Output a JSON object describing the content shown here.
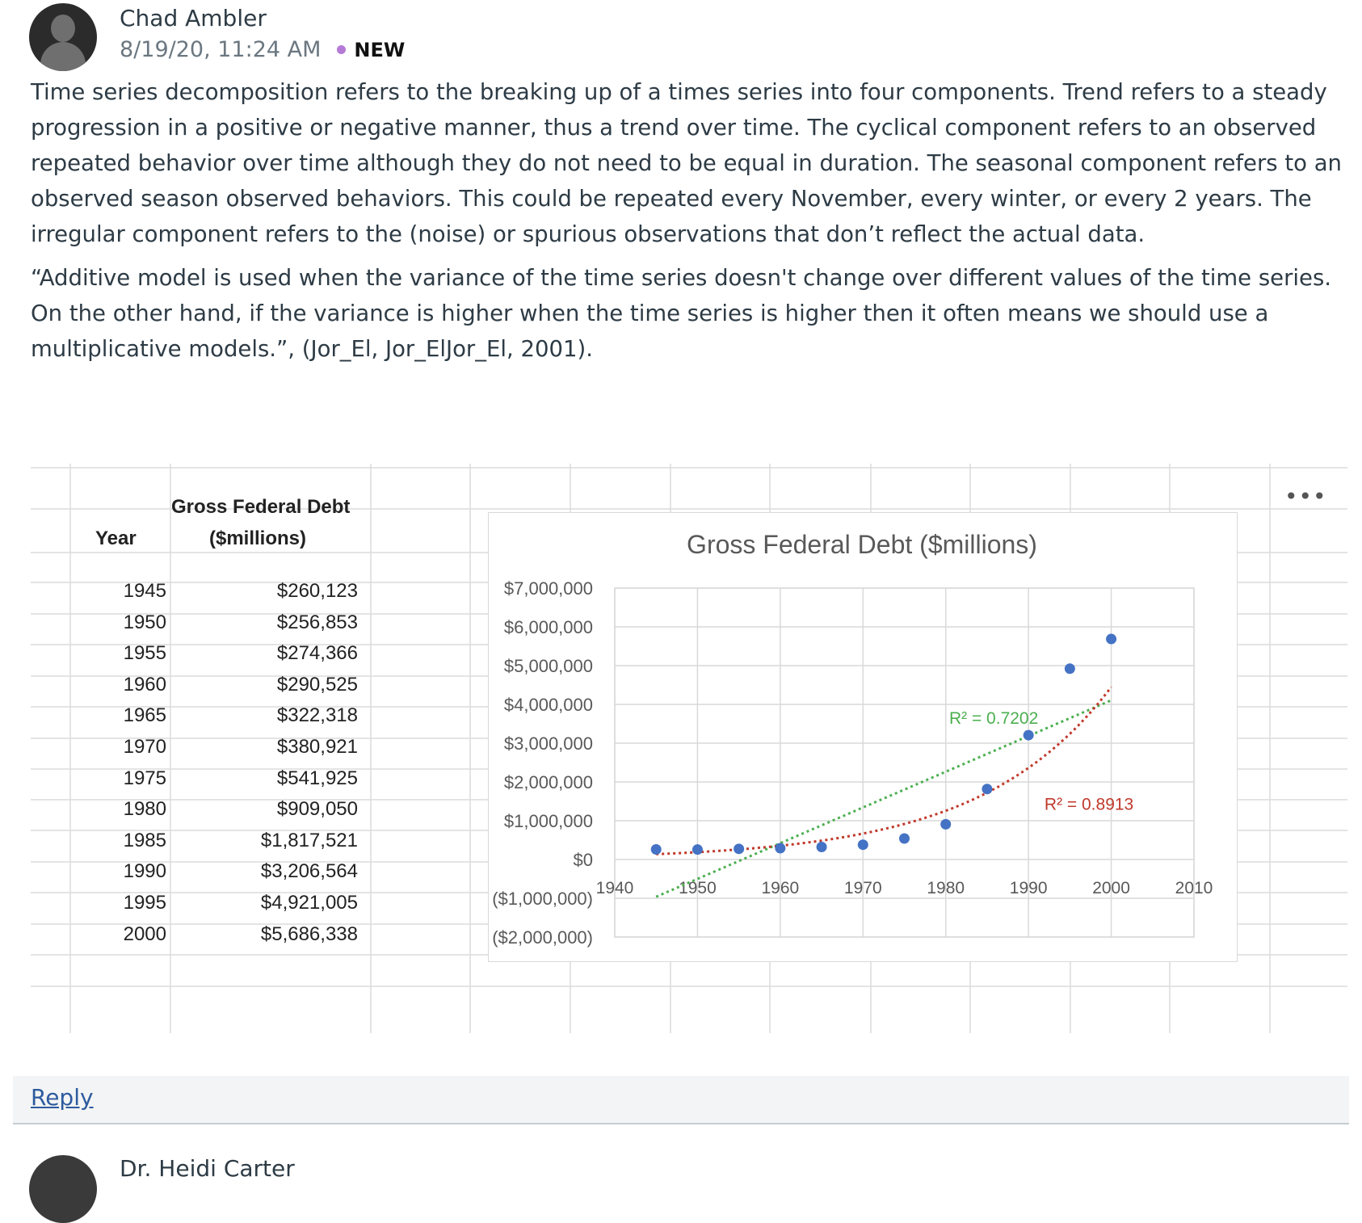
{
  "post": {
    "author": "Chad Ambler",
    "timestamp": "8/19/20, 11:24 AM",
    "badge": "NEW",
    "paragraphs": [
      "Time series decomposition refers to the breaking up of a times series into four components. Trend refers to a steady progression in a positive or negative manner, thus a trend over time. The cyclical component refers to an observed repeated behavior over time although they do not need to be equal in duration. The seasonal component refers to an observed season observed behaviors. This could be repeated every November, every winter, or every 2 years. The irregular component refers to the (noise) or spurious observations that don’t reflect the actual data.",
      "“Additive model is used when the variance of the time series doesn't change over different values of the time series. On the other hand, if the variance is higher when the time series is higher then it often means we should use a multiplicative models.”, (Jor_El, Jor_ElJor_El, 2001)."
    ],
    "more_icon": "more-horizontal-icon",
    "reply_label": "Reply"
  },
  "table": {
    "col_year": "Year",
    "col_debt_line1": "Gross Federal Debt",
    "col_debt_line2": "($millions)",
    "rows": [
      [
        "1945",
        "$260,123"
      ],
      [
        "1950",
        "$256,853"
      ],
      [
        "1955",
        "$274,366"
      ],
      [
        "1960",
        "$290,525"
      ],
      [
        "1965",
        "$322,318"
      ],
      [
        "1970",
        "$380,921"
      ],
      [
        "1975",
        "$541,925"
      ],
      [
        "1980",
        "$909,050"
      ],
      [
        "1985",
        "$1,817,521"
      ],
      [
        "1990",
        "$3,206,564"
      ],
      [
        "1995",
        "$4,921,005"
      ],
      [
        "2000",
        "$5,686,338"
      ]
    ]
  },
  "chart_data": {
    "type": "scatter",
    "title": "Gross Federal Debt ($millions)",
    "x": [
      1945,
      1950,
      1955,
      1960,
      1965,
      1970,
      1975,
      1980,
      1985,
      1990,
      1995,
      2000
    ],
    "y": [
      260123,
      256853,
      274366,
      290525,
      322318,
      380921,
      541925,
      909050,
      1817521,
      3206564,
      4921005,
      5686338
    ],
    "xlim": [
      1940,
      2010
    ],
    "ylim": [
      -2000000,
      7000000
    ],
    "x_ticks": [
      "1940",
      "1950",
      "1960",
      "1970",
      "1980",
      "1990",
      "2000",
      "2010"
    ],
    "y_ticks": [
      "$7,000,000",
      "$6,000,000",
      "$5,000,000",
      "$4,000,000",
      "$3,000,000",
      "$2,000,000",
      "$1,000,000",
      "$0",
      "($1,000,000)",
      "($2,000,000)"
    ],
    "trendlines": [
      {
        "kind": "linear",
        "r2_label": "R² = 0.7202",
        "color": "#4caf50"
      },
      {
        "kind": "exponential",
        "r2_label": "R² = 0.8913",
        "color": "#c0392b"
      }
    ],
    "marker_color": "#4472c4",
    "grid": true
  },
  "next_post": {
    "author": "Dr. Heidi Carter"
  }
}
